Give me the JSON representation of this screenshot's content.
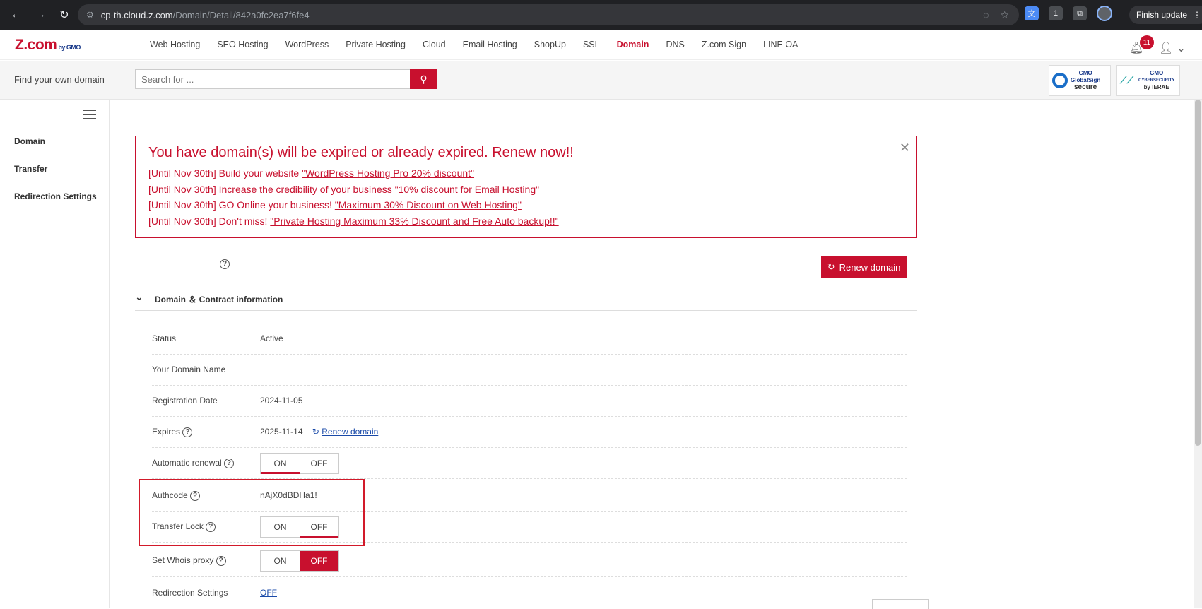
{
  "browser": {
    "url_host": "cp-th.cloud.z.com",
    "url_path": "/Domain/Detail/842a0fc2ea7f6fe4",
    "finish_update": "Finish update",
    "ext_badge": "1"
  },
  "header": {
    "logo": "Z.com",
    "logo_sub": "by GMO",
    "nav": [
      "Web Hosting",
      "SEO Hosting",
      "WordPress",
      "Private Hosting",
      "Cloud",
      "Email Hosting",
      "ShopUp",
      "SSL",
      "Domain",
      "DNS",
      "Z.com Sign",
      "LINE OA"
    ],
    "active_nav": "Domain",
    "notification_count": "11"
  },
  "search": {
    "label": "Find your own domain",
    "placeholder": "Search for ..."
  },
  "badges": {
    "globalsign_line1": "GMO",
    "globalsign_line2": "GlobalSign",
    "globalsign_line3": "secure",
    "ierae_line1": "GMO",
    "ierae_line2": "CYBERSECURITY",
    "ierae_line3": "by IERAE"
  },
  "sidebar": {
    "items": [
      "Domain",
      "Transfer",
      "Redirection Settings"
    ]
  },
  "alert": {
    "title": "You have domain(s) will be expired or already expired. Renew now!!",
    "lines": [
      {
        "prefix": "[Until Nov 30th] Build your website ",
        "link": "\"WordPress Hosting Pro 20% discount\""
      },
      {
        "prefix": "[Until Nov 30th] Increase the credibility of your business ",
        "link": "\"10% discount for Email Hosting\""
      },
      {
        "prefix": "[Until Nov 30th] GO Online your business! ",
        "link": "\"Maximum 30% Discount on Web Hosting\""
      },
      {
        "prefix": "[Until Nov 30th] Don't miss! ",
        "link": "\"Private Hosting Maximum 33% Discount and Free Auto backup!!\""
      }
    ]
  },
  "renew_button": "Renew domain",
  "section": {
    "title": "Domain ＆ Contract information"
  },
  "rows": {
    "status_label": "Status",
    "status_value": "Active",
    "domain_name_label": "Your Domain Name",
    "domain_name_value": "",
    "registration_label": "Registration Date",
    "registration_value": "2024-11-05",
    "expires_label": "Expires",
    "expires_value": "2025-11-14",
    "expires_renew_link": "Renew domain",
    "auto_renewal_label": "Automatic renewal",
    "authcode_label": "Authcode",
    "authcode_value": "nAjX0dBDHa1!",
    "transfer_lock_label": "Transfer Lock",
    "whois_label": "Set Whois proxy",
    "redirection_label": "Redirection Settings",
    "redirection_value": "OFF"
  },
  "toggle": {
    "on": "ON",
    "off": "OFF"
  },
  "accent_color": "#c8102e"
}
